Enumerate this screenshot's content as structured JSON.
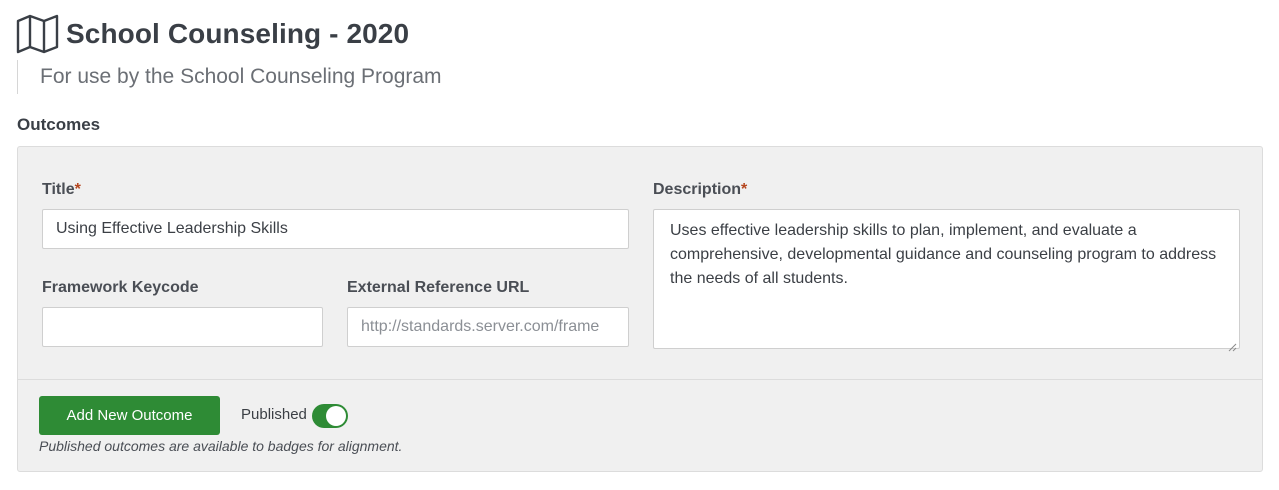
{
  "header": {
    "title": "School Counseling - 2020",
    "subtitle": "For use by the School Counseling Program",
    "icon": "map-icon"
  },
  "section": {
    "label": "Outcomes"
  },
  "form": {
    "title_label": "Title",
    "title_value": "Using Effective Leadership Skills",
    "required_marker": "*",
    "keycode_label": "Framework Keycode",
    "keycode_value": "",
    "url_label": "External Reference URL",
    "url_placeholder": "http://standards.server.com/frame",
    "description_label": "Description",
    "description_value": "Uses effective leadership skills to plan, implement, and evaluate a comprehensive, developmental guidance and counseling program to address the needs of all students."
  },
  "footer": {
    "add_button_label": "Add New Outcome",
    "published_label": "Published",
    "published_on": true,
    "hint": "Published outcomes are available to badges for alignment."
  },
  "colors": {
    "accent": "#2e8b35",
    "required": "#b5461f",
    "panel_bg": "#f0f0f0"
  }
}
